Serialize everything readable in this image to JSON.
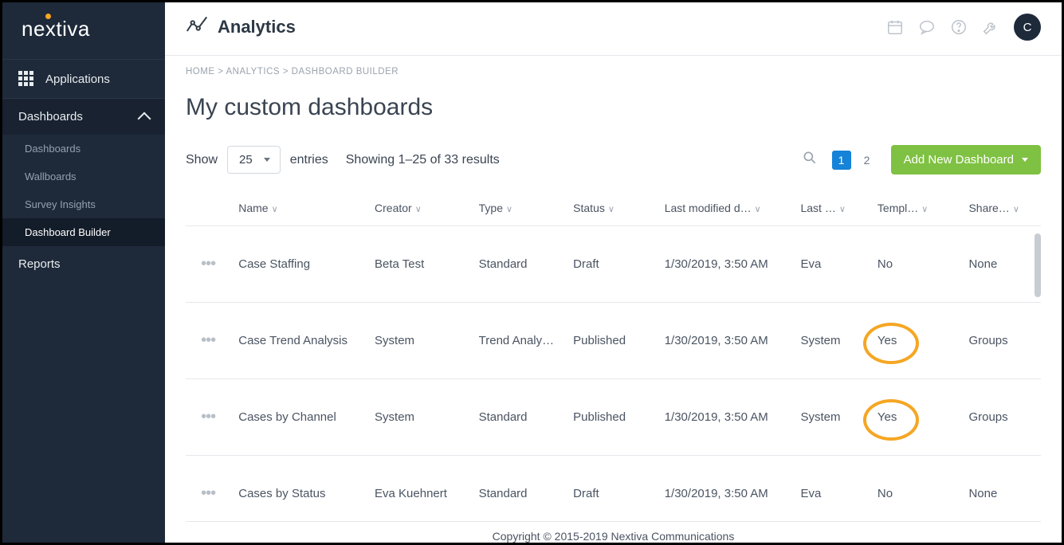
{
  "logo_text": "nextiva",
  "nav": {
    "applications": "Applications",
    "dashboards_section": "Dashboards",
    "reports": "Reports",
    "items": [
      "Dashboards",
      "Wallboards",
      "Survey Insights",
      "Dashboard Builder"
    ]
  },
  "header": {
    "title": "Analytics",
    "avatar": "C"
  },
  "breadcrumb": {
    "home": "HOME",
    "sep": " > ",
    "analytics": "ANALYTICS",
    "builder": "DASHBOARD BUILDER"
  },
  "page_title": "My custom dashboards",
  "controls": {
    "show_label": "Show",
    "show_value": "25",
    "entries_label": "entries",
    "showing_text": "Showing 1–25 of 33 results",
    "page1": "1",
    "page2": "2",
    "add_label": "Add New Dashboard"
  },
  "columns": {
    "name": "Name",
    "creator": "Creator",
    "type": "Type",
    "status": "Status",
    "modified": "Last modified d…",
    "modby": "Last …",
    "template": "Templ…",
    "shared": "Share…"
  },
  "rows": [
    {
      "name": "Case Staffing",
      "creator": "Beta Test",
      "type": "Standard",
      "status": "Draft",
      "modified": "1/30/2019, 3:50 AM",
      "modby": "Eva",
      "template": "No",
      "shared": "None",
      "hl": false
    },
    {
      "name": "Case Trend Analysis",
      "creator": "System",
      "type": "Trend Analy…",
      "status": "Published",
      "modified": "1/30/2019, 3:50 AM",
      "modby": "System",
      "template": "Yes",
      "shared": "Groups",
      "hl": true
    },
    {
      "name": "Cases by Channel",
      "creator": "System",
      "type": "Standard",
      "status": "Published",
      "modified": "1/30/2019, 3:50 AM",
      "modby": "System",
      "template": "Yes",
      "shared": "Groups",
      "hl": true
    },
    {
      "name": "Cases by Status",
      "creator": "Eva Kuehnert",
      "type": "Standard",
      "status": "Draft",
      "modified": "1/30/2019, 3:50 AM",
      "modby": "Eva",
      "template": "No",
      "shared": "None",
      "hl": false
    }
  ],
  "footer": "Copyright © 2015-2019 Nextiva Communications"
}
